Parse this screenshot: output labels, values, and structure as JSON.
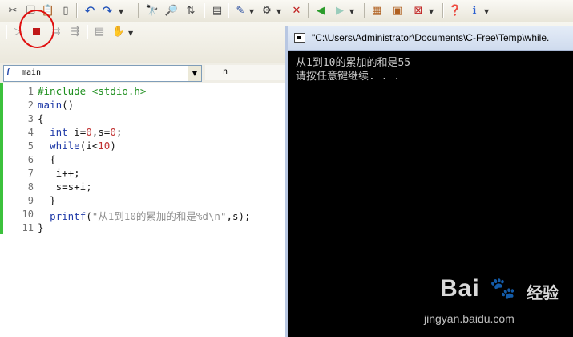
{
  "toolbar_top": {
    "icons": [
      "cut-icon",
      "copy-icon",
      "paste-icon",
      "undo-icon",
      "redo-icon",
      "find-icon",
      "find-next-icon",
      "replace-icon",
      "goto-icon",
      "compile-icon",
      "build-icon",
      "debug-icon",
      "back-icon",
      "forward-icon",
      "project-icon",
      "export-icon",
      "close-icon",
      "help-icon",
      "info-icon"
    ]
  },
  "toolbar_run": {
    "icons": [
      "run-icon",
      "stop-icon",
      "step-icon",
      "step-over-icon",
      "breakpoint-icon",
      "hand-icon"
    ]
  },
  "function_combo": {
    "icon_label": "ƒ",
    "value": "main",
    "param": "n"
  },
  "editor": {
    "lines": [
      {
        "num": "1",
        "tokens": [
          {
            "t": "#include <stdio.h>",
            "c": "pp"
          }
        ]
      },
      {
        "num": "2",
        "tokens": [
          {
            "t": "main",
            "c": "fn"
          },
          {
            "t": "()",
            "c": ""
          }
        ]
      },
      {
        "num": "3",
        "tokens": [
          {
            "t": "{",
            "c": ""
          }
        ]
      },
      {
        "num": "4",
        "tokens": [
          {
            "t": "  ",
            "c": ""
          },
          {
            "t": "int",
            "c": "kw"
          },
          {
            "t": " i=",
            "c": ""
          },
          {
            "t": "0",
            "c": "num"
          },
          {
            "t": ",s=",
            "c": ""
          },
          {
            "t": "0",
            "c": "num"
          },
          {
            "t": ";",
            "c": ""
          }
        ]
      },
      {
        "num": "5",
        "tokens": [
          {
            "t": "  ",
            "c": ""
          },
          {
            "t": "while",
            "c": "kw"
          },
          {
            "t": "(i<",
            "c": ""
          },
          {
            "t": "10",
            "c": "num"
          },
          {
            "t": ")",
            "c": ""
          }
        ]
      },
      {
        "num": "6",
        "tokens": [
          {
            "t": "  {",
            "c": ""
          }
        ]
      },
      {
        "num": "7",
        "tokens": [
          {
            "t": "   i++;",
            "c": ""
          }
        ]
      },
      {
        "num": "8",
        "tokens": [
          {
            "t": "   s=s+i;",
            "c": ""
          }
        ]
      },
      {
        "num": "9",
        "tokens": [
          {
            "t": "  }",
            "c": ""
          }
        ]
      },
      {
        "num": "10",
        "tokens": [
          {
            "t": "  ",
            "c": ""
          },
          {
            "t": "printf",
            "c": "fn"
          },
          {
            "t": "(",
            "c": ""
          },
          {
            "t": "\"从1到10的累加的和是%d\\n\"",
            "c": "str"
          },
          {
            "t": ",s);",
            "c": ""
          }
        ]
      },
      {
        "num": "11",
        "tokens": [
          {
            "t": "}",
            "c": ""
          }
        ]
      }
    ]
  },
  "console": {
    "title": "\"C:\\Users\\Administrator\\Documents\\C-Free\\Temp\\while.",
    "output": [
      "从1到10的累加的和是55",
      "请按任意键继续. . ."
    ]
  },
  "watermark": {
    "brand": "Bai",
    "brand_suffix": "经验",
    "url": "jingyan.baidu.com"
  }
}
